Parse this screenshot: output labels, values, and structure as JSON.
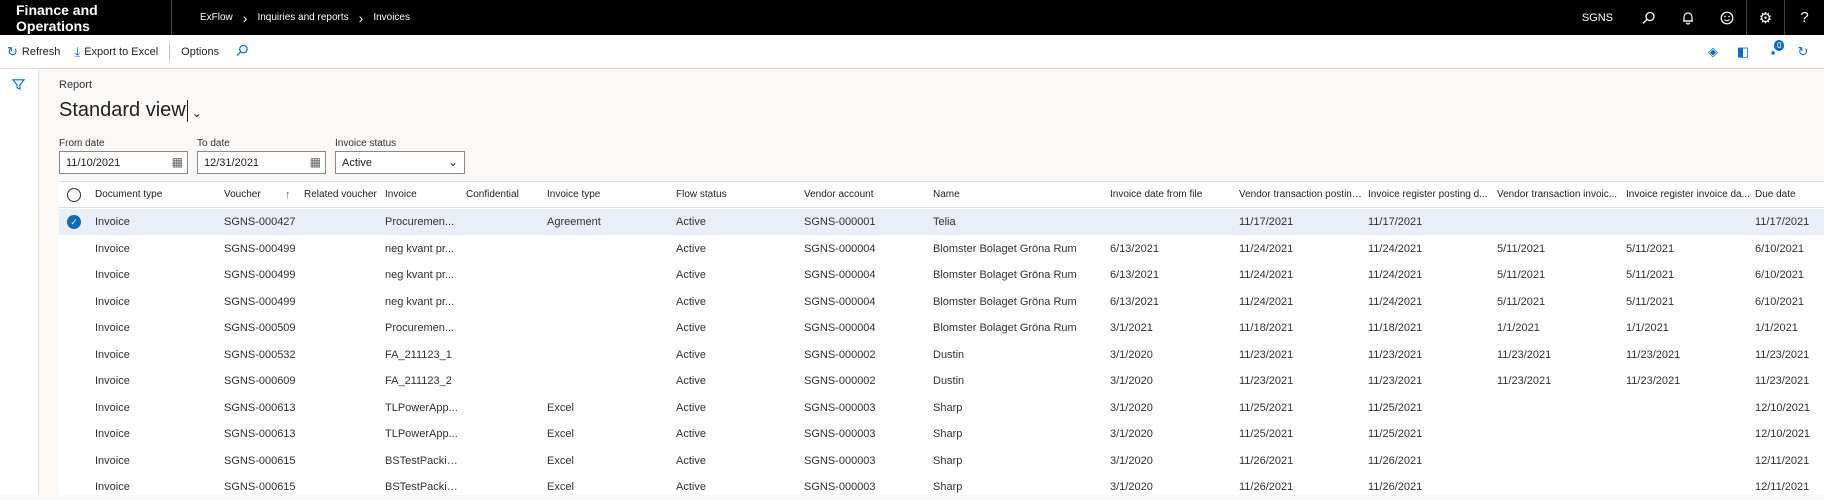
{
  "topbar": {
    "app_title": "Finance and Operations",
    "breadcrumb": [
      "ExFlow",
      "Inquiries and reports",
      "Invoices"
    ],
    "company": "SGNS",
    "icons": [
      "search-icon",
      "bell-icon",
      "smiley-icon",
      "gear-icon",
      "help-icon"
    ]
  },
  "actionbar": {
    "refresh": "Refresh",
    "export": "Export to Excel",
    "options": "Options",
    "notification_count": "0"
  },
  "page": {
    "report_label": "Report",
    "view_name": "Standard view"
  },
  "filters": {
    "from_date_label": "From date",
    "from_date": "11/10/2021",
    "to_date_label": "To date",
    "to_date": "12/31/2021",
    "status_label": "Invoice status",
    "status": "Active"
  },
  "grid": {
    "columns": [
      "Document type",
      "Voucher",
      "Related voucher",
      "Invoice",
      "Confidential",
      "Invoice type",
      "Flow status",
      "Vendor account",
      "Name",
      "Invoice date from file",
      "Vendor transaction posting...",
      "Invoice register posting d...",
      "Vendor transaction invoic...",
      "Invoice register invoice da...",
      "Due date"
    ],
    "rows": [
      [
        "Invoice",
        "SGNS-000427",
        "",
        "Procuremen...",
        "",
        "Agreement",
        "Active",
        "SGNS-000001",
        "Telia",
        "",
        "11/17/2021",
        "11/17/2021",
        "",
        "",
        "11/17/2021"
      ],
      [
        "Invoice",
        "SGNS-000499",
        "",
        "neg kvant pr...",
        "",
        "",
        "Active",
        "SGNS-000004",
        "Blomster Bolaget Gröna Rum",
        "6/13/2021",
        "11/24/2021",
        "11/24/2021",
        "5/11/2021",
        "5/11/2021",
        "6/10/2021"
      ],
      [
        "Invoice",
        "SGNS-000499",
        "",
        "neg kvant pr...",
        "",
        "",
        "Active",
        "SGNS-000004",
        "Blomster Bolaget Gröna Rum",
        "6/13/2021",
        "11/24/2021",
        "11/24/2021",
        "5/11/2021",
        "5/11/2021",
        "6/10/2021"
      ],
      [
        "Invoice",
        "SGNS-000499",
        "",
        "neg kvant pr...",
        "",
        "",
        "Active",
        "SGNS-000004",
        "Blomster Bolaget Gröna Rum",
        "6/13/2021",
        "11/24/2021",
        "11/24/2021",
        "5/11/2021",
        "5/11/2021",
        "6/10/2021"
      ],
      [
        "Invoice",
        "SGNS-000509",
        "",
        "Procuremen...",
        "",
        "",
        "Active",
        "SGNS-000004",
        "Blomster Bolaget Gröna Rum",
        "3/1/2021",
        "11/18/2021",
        "11/18/2021",
        "1/1/2021",
        "1/1/2021",
        "1/1/2021"
      ],
      [
        "Invoice",
        "SGNS-000532",
        "",
        "FA_211123_1",
        "",
        "",
        "Active",
        "SGNS-000002",
        "Dustin",
        "3/1/2020",
        "11/23/2021",
        "11/23/2021",
        "11/23/2021",
        "11/23/2021",
        "11/23/2021"
      ],
      [
        "Invoice",
        "SGNS-000609",
        "",
        "FA_211123_2",
        "",
        "",
        "Active",
        "SGNS-000002",
        "Dustin",
        "3/1/2020",
        "11/23/2021",
        "11/23/2021",
        "11/23/2021",
        "11/23/2021",
        "11/23/2021"
      ],
      [
        "Invoice",
        "SGNS-000613",
        "",
        "TLPowerApp...",
        "",
        "Excel",
        "Active",
        "SGNS-000003",
        "Sharp",
        "3/1/2020",
        "11/25/2021",
        "11/25/2021",
        "",
        "",
        "12/10/2021"
      ],
      [
        "Invoice",
        "SGNS-000613",
        "",
        "TLPowerApp...",
        "",
        "Excel",
        "Active",
        "SGNS-000003",
        "Sharp",
        "3/1/2020",
        "11/25/2021",
        "11/25/2021",
        "",
        "",
        "12/10/2021"
      ],
      [
        "Invoice",
        "SGNS-000615",
        "",
        "BSTestPackin...",
        "",
        "Excel",
        "Active",
        "SGNS-000003",
        "Sharp",
        "3/1/2020",
        "11/26/2021",
        "11/26/2021",
        "",
        "",
        "12/11/2021"
      ],
      [
        "Invoice",
        "SGNS-000615",
        "",
        "BSTestPackin...",
        "",
        "Excel",
        "Active",
        "SGNS-000003",
        "Sharp",
        "3/1/2020",
        "11/26/2021",
        "11/26/2021",
        "",
        "",
        "12/11/2021"
      ]
    ],
    "selected_row": 0
  }
}
